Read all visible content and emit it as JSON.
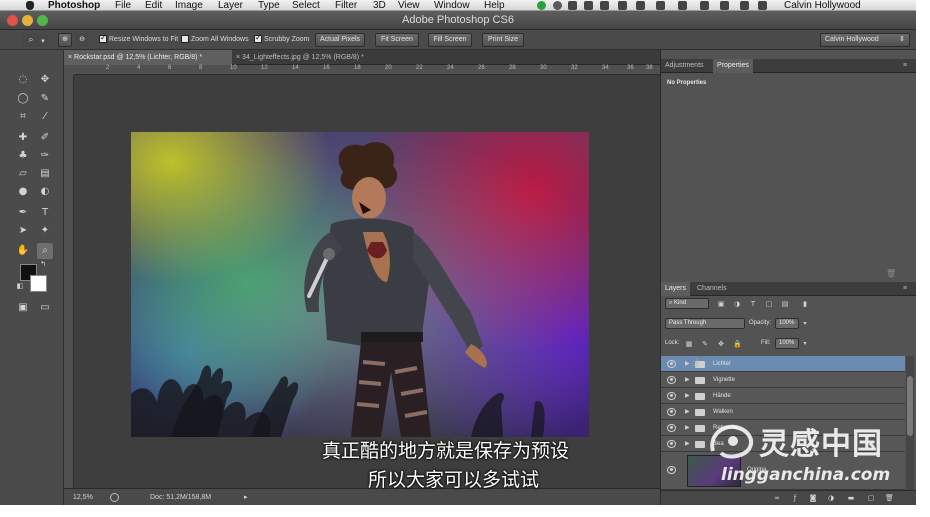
{
  "menubar": {
    "items": [
      "Photoshop",
      "File",
      "Edit",
      "Image",
      "Layer",
      "Type",
      "Select",
      "Filter",
      "3D",
      "View",
      "Window",
      "Help"
    ],
    "user": "Calvin Hollywood"
  },
  "window": {
    "title": "Adobe Photoshop CS6"
  },
  "options": {
    "resize_windows": "Resize Windows to Fit",
    "zoom_all": "Zoom All Windows",
    "scrubby_zoom": "Scrubby Zoom",
    "actual_pixels": "Actual Pixels",
    "fit_screen": "Fit Screen",
    "fill_screen": "Fill Screen",
    "print_size": "Print Size",
    "workspace": "Calvin Hollywood"
  },
  "tabs": [
    {
      "label": "Rockstar.psd @ 12,5% (Lichter, RGB/8) *"
    },
    {
      "label": "34_Lighteffects.jpg @ 12,5% (RGB/8) *"
    }
  ],
  "ruler": {
    "ticks": [
      "2",
      "4",
      "6",
      "8",
      "10",
      "12",
      "14",
      "16",
      "18",
      "20",
      "22",
      "24",
      "26",
      "28",
      "30",
      "32",
      "34",
      "36",
      "38"
    ]
  },
  "status": {
    "zoom": "12,5%",
    "doc": "Doc: 51,2M/158,8M"
  },
  "properties": {
    "tabs": [
      "Adjustments",
      "Properties"
    ],
    "empty": "No Properties"
  },
  "layers": {
    "tabs": [
      "Layers",
      "Channels"
    ],
    "filter_kind": "Kind",
    "blend": "Pass Through",
    "opacity_label": "Opacity:",
    "opacity": "100%",
    "lock_label": "Lock:",
    "fill_label": "Fill:",
    "fill": "100%",
    "items": [
      {
        "name": "Lichter"
      },
      {
        "name": "Vignette"
      },
      {
        "name": "Hände"
      },
      {
        "name": "Walken"
      },
      {
        "name": "Retusche"
      },
      {
        "name": "Bea"
      }
    ],
    "thumb_name": "Origina"
  },
  "subtitles": {
    "line1": "真正酷的地方就是保存为预设",
    "line2": "所以大家可以多试试"
  },
  "watermark": {
    "cn": "灵感中国",
    "url": "lingganchina.com"
  },
  "colors": {
    "accent_selection": "#6b8cb0",
    "window_bg": "#535353"
  }
}
